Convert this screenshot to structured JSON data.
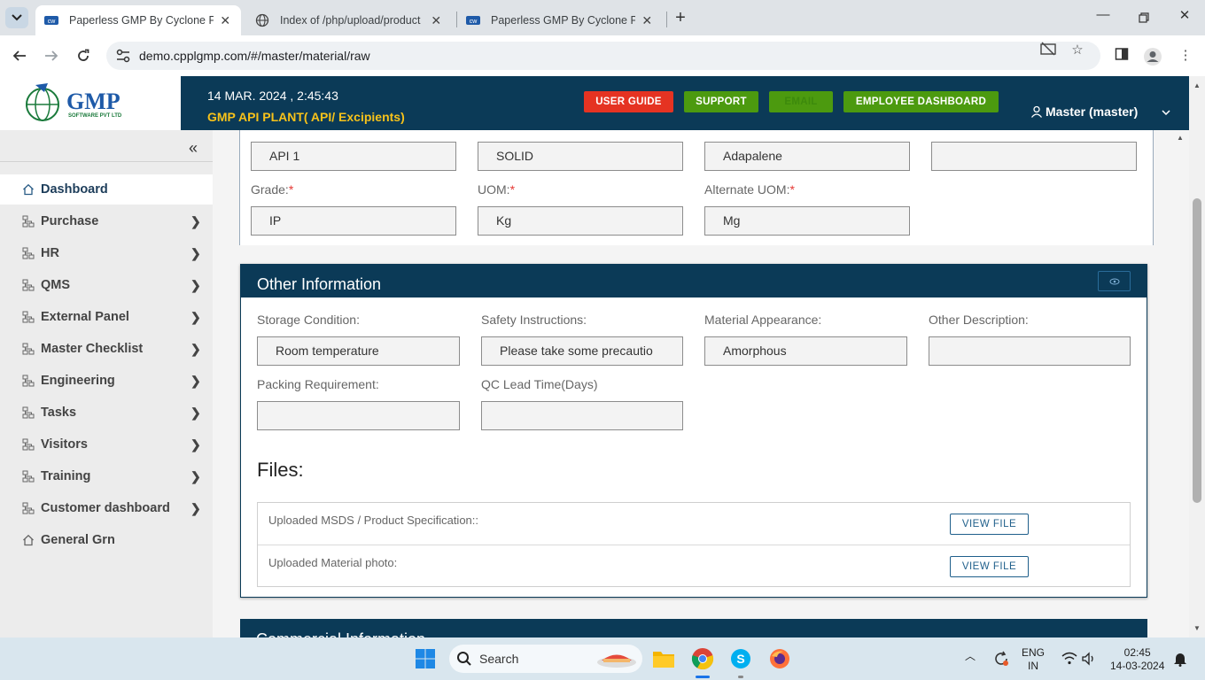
{
  "browser": {
    "tabs": [
      {
        "title": "Paperless GMP By Cyclone Pharma",
        "active": true
      },
      {
        "title": "Index of /php/upload/product",
        "active": false
      },
      {
        "title": "Paperless GMP By Cyclone Pharma",
        "active": false
      }
    ],
    "url": "demo.cpplgmp.com/#/master/material/raw"
  },
  "header": {
    "logo_text": "GMP",
    "logo_subtext": "SOFTWARE PVT LTD",
    "datetime": "14 MAR. 2024 , 2:45:43",
    "plant": "GMP API PLANT( API/ Excipients)",
    "buttons": {
      "user_guide": "USER GUIDE",
      "support": "SUPPORT",
      "email": "EMAIL",
      "employee_dashboard": "EMPLOYEE DASHBOARD"
    },
    "user": "Master (master)",
    "colors": {
      "user_guide": "#e53322",
      "support": "#4c9a0f",
      "email": "#4c9a0f",
      "employee_dashboard": "#4c9a0f"
    }
  },
  "sidebar": {
    "items": [
      {
        "label": "Dashboard",
        "icon": "home-icon",
        "has_children": false
      },
      {
        "label": "Purchase",
        "icon": "org-icon",
        "has_children": true
      },
      {
        "label": "HR",
        "icon": "org-icon",
        "has_children": true
      },
      {
        "label": "QMS",
        "icon": "org-icon",
        "has_children": true
      },
      {
        "label": "External Panel",
        "icon": "org-icon",
        "has_children": true
      },
      {
        "label": "Master Checklist",
        "icon": "org-icon",
        "has_children": true
      },
      {
        "label": "Engineering",
        "icon": "org-icon",
        "has_children": true
      },
      {
        "label": "Tasks",
        "icon": "org-icon",
        "has_children": true
      },
      {
        "label": "Visitors",
        "icon": "org-icon",
        "has_children": true
      },
      {
        "label": "Training",
        "icon": "org-icon",
        "has_children": true
      },
      {
        "label": "Customer dashboard",
        "icon": "org-icon",
        "has_children": true
      },
      {
        "label": "General Grn",
        "icon": "home-icon",
        "has_children": false
      }
    ]
  },
  "material": {
    "row1": [
      "API 1",
      "SOLID",
      "Adapalene",
      ""
    ],
    "grade_label": "Grade:",
    "grade": "IP",
    "uom_label": "UOM:",
    "uom": "Kg",
    "alt_uom_label": "Alternate UOM:",
    "alt_uom": "Mg",
    "required_mark": "*"
  },
  "other_info": {
    "title": "Other Information",
    "storage_label": "Storage Condition:",
    "storage": "Room temperature",
    "safety_label": "Safety Instructions:",
    "safety": "Please take some precautio",
    "appearance_label": "Material Appearance:",
    "appearance": "Amorphous",
    "other_desc_label": "Other Description:",
    "other_desc": "",
    "packing_label": "Packing Requirement:",
    "packing": "",
    "qc_lead_label": "QC Lead Time(Days)",
    "qc_lead": ""
  },
  "files": {
    "title": "Files:",
    "rows": [
      {
        "label": "Uploaded MSDS / Product Specification::",
        "button": "VIEW FILE"
      },
      {
        "label": "Uploaded Material photo:",
        "button": "VIEW FILE"
      }
    ]
  },
  "commercial": {
    "title": "Commercial Information"
  },
  "taskbar": {
    "search_placeholder": "Search",
    "lang_top": "ENG",
    "lang_bottom": "IN",
    "time": "02:45",
    "date": "14-03-2024"
  }
}
